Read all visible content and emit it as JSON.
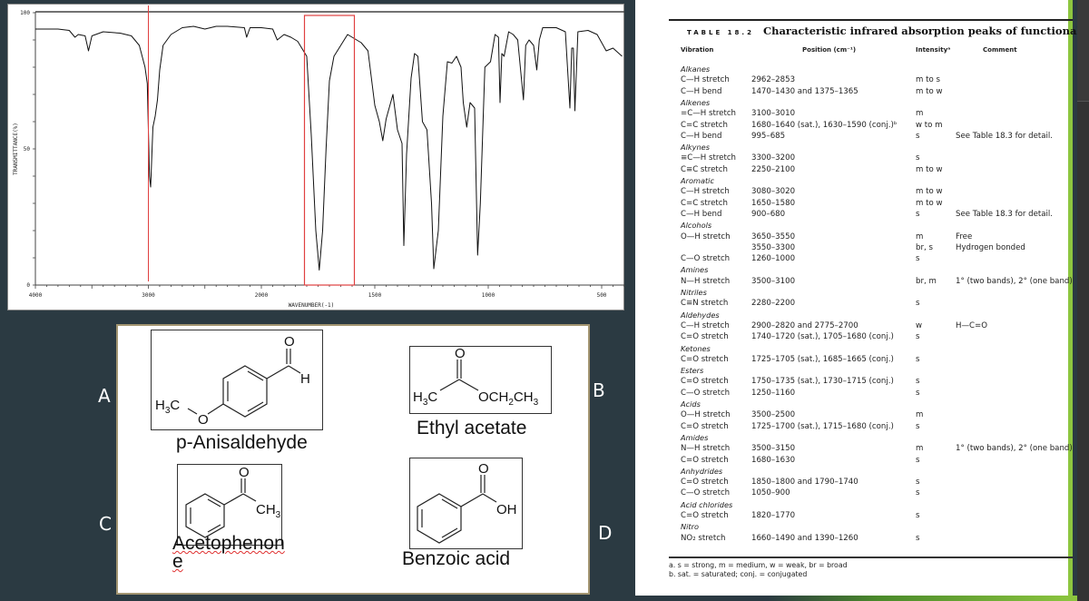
{
  "spectrum": {
    "chart_data": {
      "type": "line",
      "title": "",
      "xlabel": "WAVENUMBER(-1)",
      "ylabel": "TRANSMITTANCE(%)",
      "xlim": [
        4000,
        400
      ],
      "ylim": [
        0,
        100
      ],
      "x_ticks": [
        "4000",
        "3000",
        "2000",
        "1500",
        "1000",
        "500"
      ],
      "y_ticks": [
        "0",
        "50",
        "100"
      ],
      "grid": false,
      "series": [
        {
          "name": "IR spectrum",
          "points": [
            [
              4000,
              94
            ],
            [
              3800,
              94
            ],
            [
              3700,
              93.5
            ],
            [
              3650,
              91
            ],
            [
              3620,
              92
            ],
            [
              3560,
              91.5
            ],
            [
              3530,
              86
            ],
            [
              3500,
              91.5
            ],
            [
              3400,
              93
            ],
            [
              3250,
              92.5
            ],
            [
              3150,
              91.5
            ],
            [
              3080,
              88
            ],
            [
              3030,
              80
            ],
            [
              3010,
              74
            ],
            [
              2990,
              40
            ],
            [
              2980,
              36
            ],
            [
              2960,
              58
            ],
            [
              2940,
              62
            ],
            [
              2920,
              68
            ],
            [
              2900,
              79
            ],
            [
              2870,
              88
            ],
            [
              2800,
              92
            ],
            [
              2700,
              94.5
            ],
            [
              2600,
              95
            ],
            [
              2500,
              94
            ],
            [
              2400,
              95
            ],
            [
              2300,
              95
            ],
            [
              2150,
              94.5
            ],
            [
              2130,
              91
            ],
            [
              2100,
              94.5
            ],
            [
              2000,
              94.5
            ],
            [
              1950,
              94
            ],
            [
              1930,
              90
            ],
            [
              1900,
              92
            ],
            [
              1870,
              91
            ],
            [
              1840,
              89.5
            ],
            [
              1800,
              84
            ],
            [
              1780,
              55
            ],
            [
              1760,
              20
            ],
            [
              1745,
              5.5
            ],
            [
              1730,
              20
            ],
            [
              1715,
              50
            ],
            [
              1700,
              75
            ],
            [
              1680,
              84
            ],
            [
              1650,
              88
            ],
            [
              1620,
              92
            ],
            [
              1600,
              91
            ],
            [
              1560,
              89
            ],
            [
              1530,
              86
            ],
            [
              1500,
              66
            ],
            [
              1480,
              60
            ],
            [
              1465,
              53
            ],
            [
              1450,
              61
            ],
            [
              1420,
              70
            ],
            [
              1400,
              57
            ],
            [
              1380,
              52
            ],
            [
              1372,
              14.5
            ],
            [
              1360,
              48
            ],
            [
              1340,
              76
            ],
            [
              1325,
              85
            ],
            [
              1310,
              84
            ],
            [
              1290,
              60
            ],
            [
              1270,
              57
            ],
            [
              1250,
              30
            ],
            [
              1240,
              6
            ],
            [
              1220,
              20
            ],
            [
              1200,
              62
            ],
            [
              1180,
              82
            ],
            [
              1160,
              81.5
            ],
            [
              1140,
              84
            ],
            [
              1120,
              80
            ],
            [
              1110,
              67
            ],
            [
              1095,
              58
            ],
            [
              1080,
              67
            ],
            [
              1060,
              65
            ],
            [
              1047,
              11
            ],
            [
              1035,
              30
            ],
            [
              1015,
              80
            ],
            [
              990,
              82
            ],
            [
              970,
              92
            ],
            [
              955,
              91
            ],
            [
              948,
              67
            ],
            [
              940,
              85
            ],
            [
              930,
              84
            ],
            [
              910,
              93
            ],
            [
              890,
              92
            ],
            [
              870,
              90
            ],
            [
              845,
              68
            ],
            [
              835,
              88
            ],
            [
              820,
              90
            ],
            [
              800,
              88
            ],
            [
              786,
              79
            ],
            [
              775,
              90
            ],
            [
              760,
              94.5
            ],
            [
              700,
              94.5
            ],
            [
              660,
              93
            ],
            [
              640,
              65
            ],
            [
              632,
              87
            ],
            [
              625,
              87
            ],
            [
              618,
              64
            ],
            [
              605,
              93
            ],
            [
              560,
              93.5
            ],
            [
              520,
              92
            ],
            [
              480,
              86
            ],
            [
              450,
              87
            ],
            [
              410,
              84
            ]
          ]
        }
      ]
    },
    "annotations": {
      "highlight_line_wavenumber": 3000,
      "highlight_box_range": [
        1810,
        1590
      ],
      "highlight_color": "#e04040"
    }
  },
  "structures": {
    "side_labels": [
      "A",
      "B",
      "C",
      "D"
    ],
    "molecules": [
      {
        "label": "A",
        "name": "p-Anisaldehyde",
        "atoms": {
          "o": "O",
          "h": "H",
          "ome_o": "O",
          "ch3": "H",
          "ch3_sub": "3",
          "ch3_c": "C"
        }
      },
      {
        "label": "B",
        "name": "Ethyl acetate",
        "atoms": {
          "o": "O",
          "left": "H",
          "left_sub": "3",
          "left_c": "C",
          "right": "OCH",
          "right_sub1": "2",
          "right_mid": "CH",
          "right_sub2": "3"
        }
      },
      {
        "label": "C",
        "name_line1": "Acetophenon",
        "name_line2": "e",
        "atoms": {
          "o": "O",
          "ch": "CH",
          "sub": "3"
        }
      },
      {
        "label": "D",
        "name": "Benzoic acid",
        "atoms": {
          "o": "O",
          "oh": "OH"
        }
      }
    ]
  },
  "table": {
    "number": "TABLE 18.2",
    "title": "Characteristic infrared absorption peaks of functional groups",
    "headers": [
      "Vibration",
      "Position (cm⁻¹)",
      "Intensityᵃ",
      "Comment"
    ],
    "rows": [
      {
        "group": "Alkanes"
      },
      {
        "vib": "C—H stretch",
        "pos": "2962–2853",
        "int": "m to s",
        "com": ""
      },
      {
        "vib": "C—H bend",
        "pos": "1470–1430 and 1375–1365",
        "int": "m to w",
        "com": ""
      },
      {
        "group": "Alkenes"
      },
      {
        "vib": "=C—H stretch",
        "pos": "3100–3010",
        "int": "m",
        "com": ""
      },
      {
        "vib": "C=C stretch",
        "pos": "1680–1640 (sat.), 1630–1590 (conj.)ᵇ",
        "int": "w to m",
        "com": ""
      },
      {
        "vib": "C—H bend",
        "pos": "995–685",
        "int": "s",
        "com": "See Table 18.3 for detail."
      },
      {
        "group": "Alkynes"
      },
      {
        "vib": "≡C—H stretch",
        "pos": "3300–3200",
        "int": "s",
        "com": ""
      },
      {
        "vib": "C≡C stretch",
        "pos": "2250–2100",
        "int": "m to w",
        "com": ""
      },
      {
        "group": "Aromatic"
      },
      {
        "vib": "C—H stretch",
        "pos": "3080–3020",
        "int": "m to w",
        "com": ""
      },
      {
        "vib": "C=C stretch",
        "pos": "1650–1580",
        "int": "m to w",
        "com": ""
      },
      {
        "vib": "C—H bend",
        "pos": "900–680",
        "int": "s",
        "com": "See Table 18.3 for detail."
      },
      {
        "group": "Alcohols"
      },
      {
        "vib": "O—H stretch",
        "pos": "3650–3550",
        "int": "m",
        "com": "Free"
      },
      {
        "vib": "",
        "pos": "3550–3300",
        "int": "br, s",
        "com": "Hydrogen bonded"
      },
      {
        "vib": "C—O stretch",
        "pos": "1260–1000",
        "int": "s",
        "com": ""
      },
      {
        "group": "Amines"
      },
      {
        "vib": "N—H stretch",
        "pos": "3500–3100",
        "int": "br, m",
        "com": "1° (two bands), 2° (one band)"
      },
      {
        "group": "Nitriles"
      },
      {
        "vib": "C≡N stretch",
        "pos": "2280–2200",
        "int": "s",
        "com": ""
      },
      {
        "group": "Aldehydes"
      },
      {
        "vib": "C—H stretch",
        "pos": "2900–2820 and 2775–2700",
        "int": "w",
        "com": "H—C=O"
      },
      {
        "vib": "C=O stretch",
        "pos": "1740–1720 (sat.), 1705–1680 (conj.)",
        "int": "s",
        "com": ""
      },
      {
        "group": "Ketones"
      },
      {
        "vib": "C=O stretch",
        "pos": "1725–1705 (sat.), 1685–1665 (conj.)",
        "int": "s",
        "com": ""
      },
      {
        "group": "Esters"
      },
      {
        "vib": "C=O stretch",
        "pos": "1750–1735 (sat.), 1730–1715 (conj.)",
        "int": "s",
        "com": ""
      },
      {
        "vib": "C—O stretch",
        "pos": "1250–1160",
        "int": "s",
        "com": ""
      },
      {
        "group": "Acids"
      },
      {
        "vib": "O—H stretch",
        "pos": "3500–2500",
        "int": "m",
        "com": ""
      },
      {
        "vib": "C=O stretch",
        "pos": "1725–1700 (sat.), 1715–1680 (conj.)",
        "int": "s",
        "com": ""
      },
      {
        "group": "Amides"
      },
      {
        "vib": "N—H stretch",
        "pos": "3500–3150",
        "int": "m",
        "com": "1° (two bands), 2° (one band)"
      },
      {
        "vib": "C=O stretch",
        "pos": "1680–1630",
        "int": "s",
        "com": ""
      },
      {
        "group": "Anhydrides"
      },
      {
        "vib": "C=O stretch",
        "pos": "1850–1800 and 1790–1740",
        "int": "s",
        "com": ""
      },
      {
        "vib": "C—O stretch",
        "pos": "1050–900",
        "int": "s",
        "com": ""
      },
      {
        "group": "Acid chlorides"
      },
      {
        "vib": "C=O stretch",
        "pos": "1820–1770",
        "int": "s",
        "com": ""
      },
      {
        "group": "Nitro"
      },
      {
        "vib": "NO₂ stretch",
        "pos": "1660–1490 and 1390–1260",
        "int": "s",
        "com": ""
      }
    ],
    "footnotes": [
      "a. s = strong, m = medium, w = weak, br = broad",
      "b. sat. = saturated; conj. = conjugated"
    ]
  }
}
